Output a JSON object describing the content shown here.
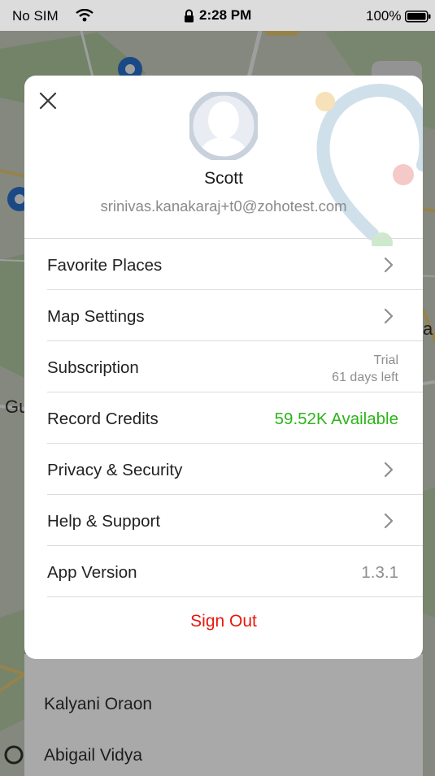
{
  "status_bar": {
    "carrier": "No SIM",
    "time": "2:28 PM",
    "battery": "100%"
  },
  "account": {
    "name": "Scott",
    "email": "srinivas.kanakaraj+t0@zohotest.com"
  },
  "menu": {
    "favorite_places": "Favorite Places",
    "map_settings": "Map Settings",
    "subscription": "Subscription",
    "subscription_plan": "Trial",
    "subscription_days": "61 days left",
    "record_credits": "Record Credits",
    "record_credits_value": "59.52K Available",
    "privacy_security": "Privacy & Security",
    "help_support": "Help & Support",
    "app_version": "App Version",
    "app_version_value": "1.3.1"
  },
  "sign_out": "Sign Out",
  "background": {
    "list_items": [
      "Kalyani Oraon",
      "Abigail Vidya"
    ],
    "map_labels": [
      "Gu",
      "a"
    ]
  },
  "colors": {
    "credits_green": "#2bb51a",
    "sign_out_red": "#e8180c",
    "label_text": "#222222",
    "secondary_text": "#8e8e8e"
  }
}
